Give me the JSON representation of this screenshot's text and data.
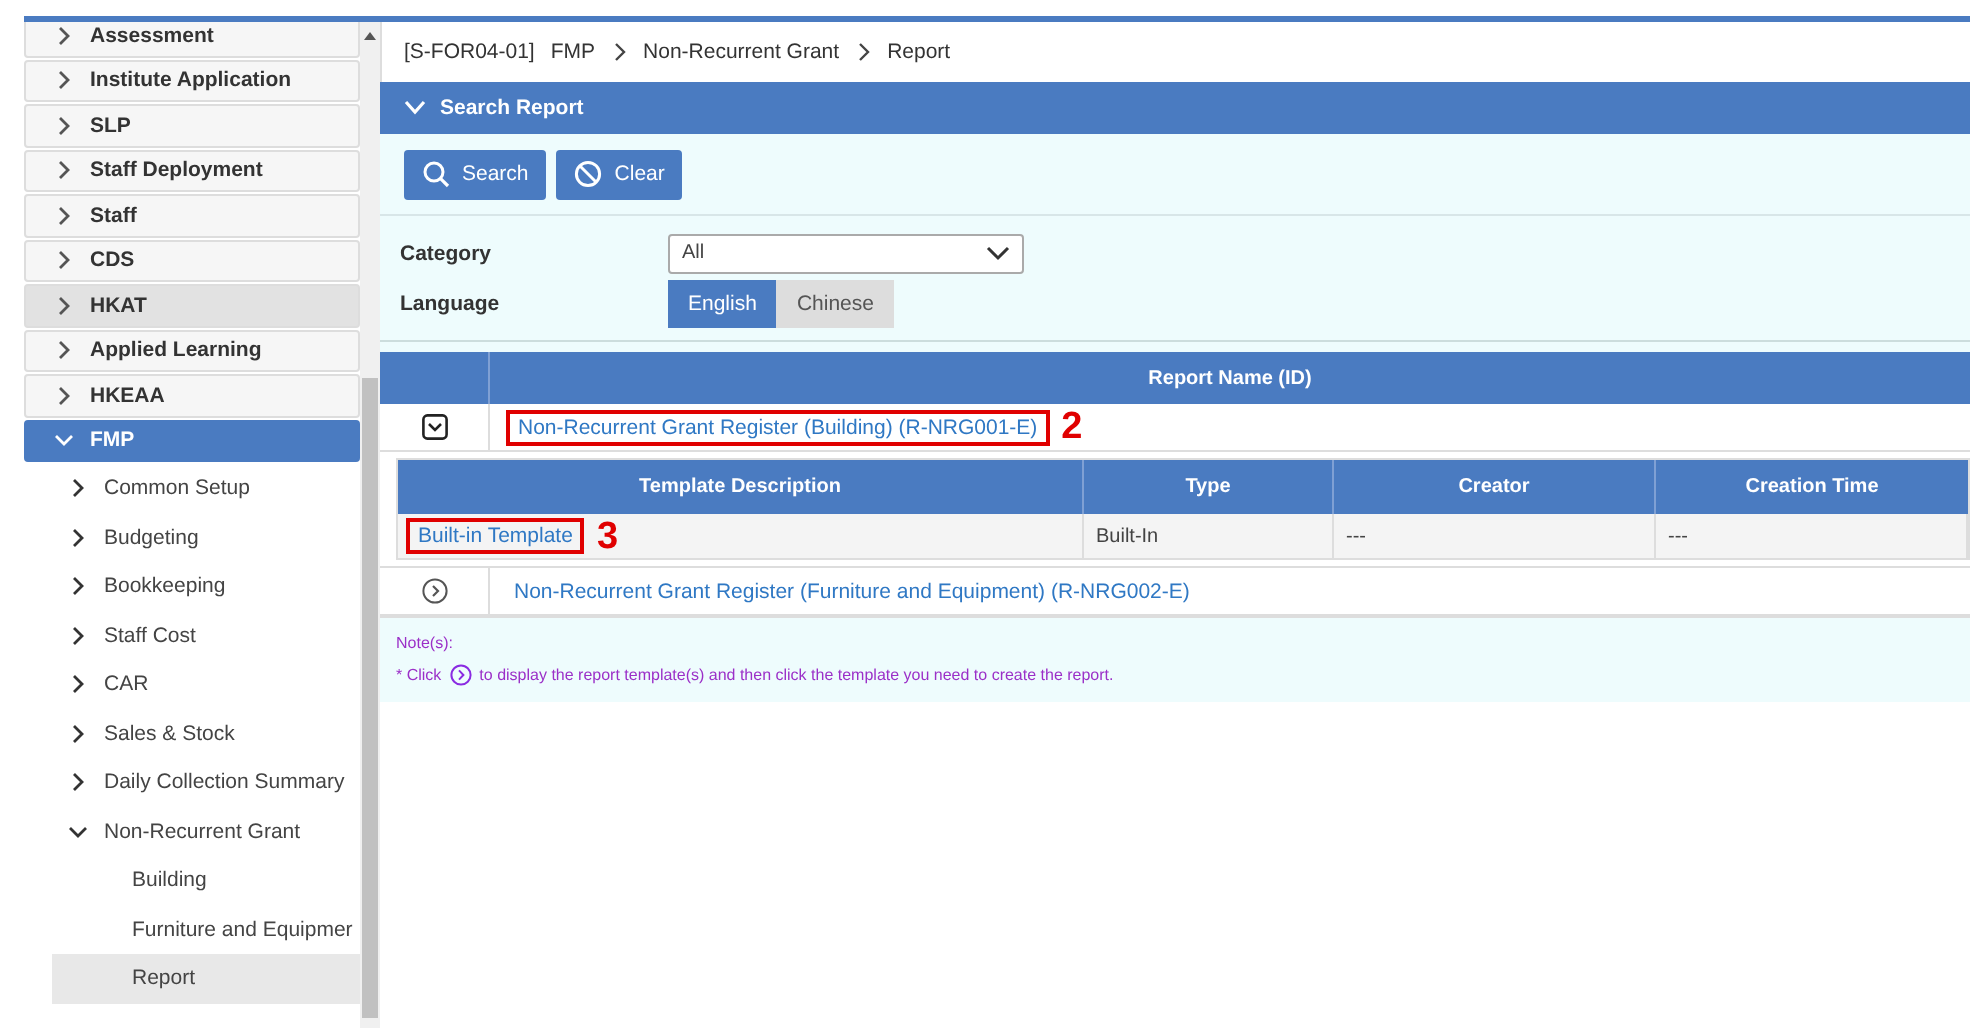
{
  "sidebar": {
    "items": [
      {
        "label": "Assessment",
        "expanded": false,
        "selected": false,
        "hovered": false
      },
      {
        "label": "Institute Application",
        "expanded": false,
        "selected": false,
        "hovered": false
      },
      {
        "label": "SLP",
        "expanded": false,
        "selected": false,
        "hovered": false
      },
      {
        "label": "Staff Deployment",
        "expanded": false,
        "selected": false,
        "hovered": false
      },
      {
        "label": "Staff",
        "expanded": false,
        "selected": false,
        "hovered": false
      },
      {
        "label": "CDS",
        "expanded": false,
        "selected": false,
        "hovered": false
      },
      {
        "label": "HKAT",
        "expanded": false,
        "selected": false,
        "hovered": true
      },
      {
        "label": "Applied Learning",
        "expanded": false,
        "selected": false,
        "hovered": false
      },
      {
        "label": "HKEAA",
        "expanded": false,
        "selected": false,
        "hovered": false
      },
      {
        "label": "FMP",
        "expanded": true,
        "selected": true,
        "hovered": false,
        "children": [
          {
            "label": "Common Setup",
            "expanded": false,
            "selected": false
          },
          {
            "label": "Budgeting",
            "expanded": false,
            "selected": false
          },
          {
            "label": "Bookkeeping",
            "expanded": false,
            "selected": false
          },
          {
            "label": "Staff Cost",
            "expanded": false,
            "selected": false
          },
          {
            "label": "CAR",
            "expanded": false,
            "selected": false
          },
          {
            "label": "Sales & Stock",
            "expanded": false,
            "selected": false
          },
          {
            "label": "Daily Collection Summary",
            "expanded": false,
            "selected": false
          },
          {
            "label": "Non-Recurrent Grant",
            "expanded": true,
            "selected": false,
            "children": [
              {
                "label": "Building",
                "selected": false
              },
              {
                "label": "Furniture and Equipmer",
                "selected": false
              },
              {
                "label": "Report",
                "selected": true
              }
            ]
          }
        ]
      }
    ]
  },
  "breadcrumb": {
    "code": "[S-FOR04-01]",
    "path": [
      "FMP",
      "Non-Recurrent Grant",
      "Report"
    ]
  },
  "search_panel": {
    "title": "Search Report",
    "expanded": true,
    "buttons": [
      {
        "label": "Search",
        "kind": "search"
      },
      {
        "label": "Clear",
        "kind": "clear"
      }
    ],
    "category": {
      "label": "Category",
      "value": "All"
    },
    "language": {
      "label": "Language",
      "options": [
        {
          "label": "English",
          "selected": true
        },
        {
          "label": "Chinese",
          "selected": false
        }
      ]
    }
  },
  "table": {
    "columns": [
      "Report Name (ID)"
    ],
    "rows": [
      {
        "name": "Non-Recurrent Grant Register (Building) (R-NRG001-E)",
        "expanded": true,
        "annotation": "2",
        "templates": {
          "columns": [
            "Template Description",
            "Type",
            "Creator",
            "Creation Time"
          ],
          "rows": [
            {
              "description": "Built-in Template",
              "annotation": "3",
              "type": "Built-In",
              "creator": "---",
              "creation_time": "---"
            }
          ]
        }
      },
      {
        "name": "Non-Recurrent Grant Register (Furniture and Equipment) (R-NRG002-E)",
        "expanded": false
      }
    ]
  },
  "notes": {
    "title": "Note(s):",
    "before": "* Click",
    "after": "to display the report template(s) and then click the template you need to create the report."
  }
}
